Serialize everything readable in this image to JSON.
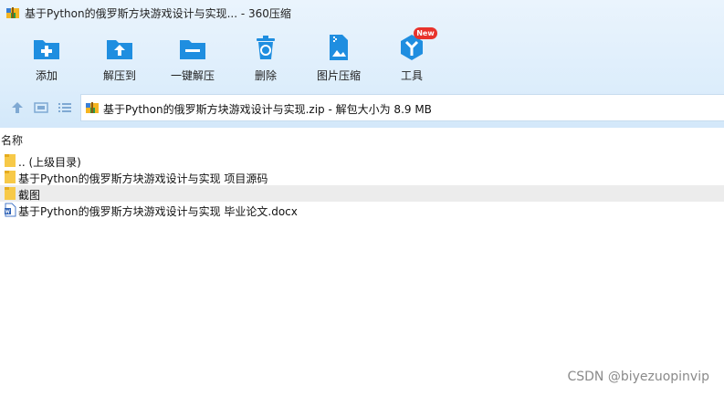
{
  "window": {
    "title": "基于Python的俄罗斯方块游戏设计与实现... - 360压缩"
  },
  "toolbar": {
    "items": [
      {
        "label": "添加",
        "icon": "add-icon"
      },
      {
        "label": "解压到",
        "icon": "extract-to-icon"
      },
      {
        "label": "一键解压",
        "icon": "one-click-extract-icon"
      },
      {
        "label": "删除",
        "icon": "delete-icon"
      },
      {
        "label": "图片压缩",
        "icon": "image-compress-icon"
      },
      {
        "label": "工具",
        "icon": "tools-icon"
      }
    ],
    "new_badge": "New"
  },
  "nav": {
    "path": "基于Python的俄罗斯方块游戏设计与实现.zip - 解包大小为 8.9 MB"
  },
  "list": {
    "header": "名称",
    "rows": [
      {
        "name": ".. (上级目录)",
        "type": "folder"
      },
      {
        "name": "基于Python的俄罗斯方块游戏设计与实现 项目源码",
        "type": "folder"
      },
      {
        "name": "截图",
        "type": "folder"
      },
      {
        "name": "基于Python的俄罗斯方块游戏设计与实现 毕业论文.docx",
        "type": "docx"
      }
    ]
  },
  "watermark": "CSDN @biyezuopinvip",
  "colors": {
    "accent": "#1f8ee0",
    "folder": "#f7c948",
    "badge": "#e8332c"
  }
}
